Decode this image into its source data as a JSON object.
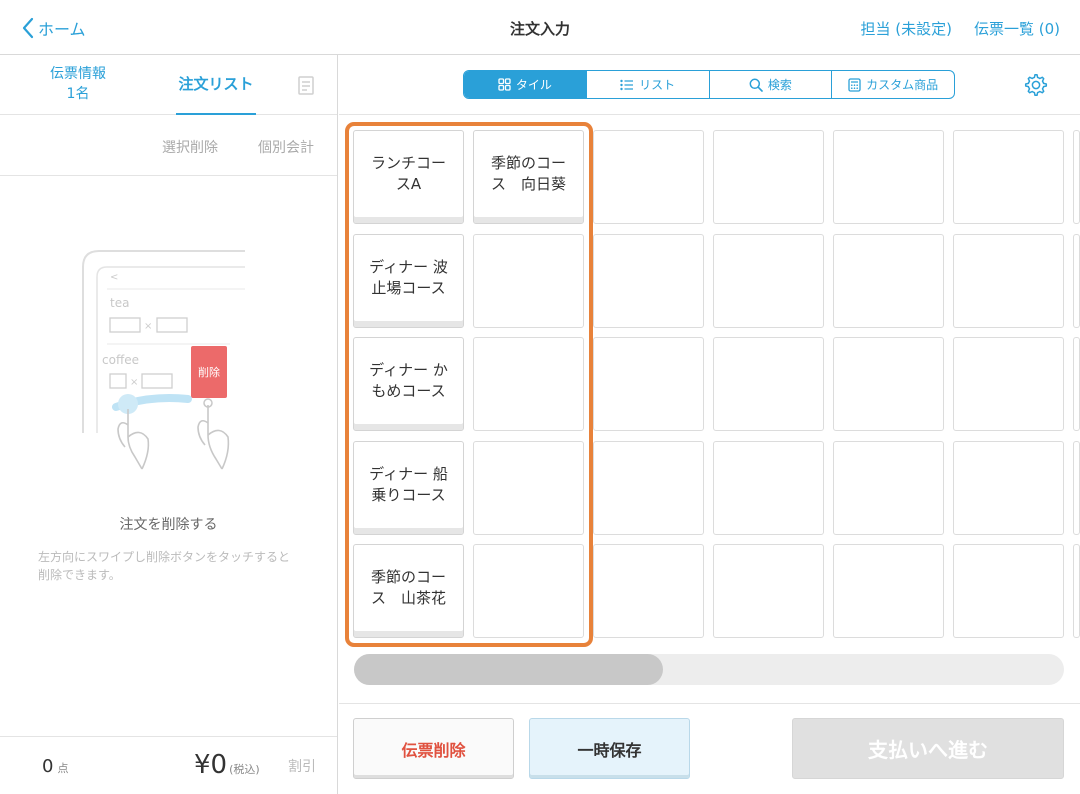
{
  "header": {
    "back_label": "ホーム",
    "title": "注文入力",
    "staff_label": "担当 (未設定)",
    "slips_label": "伝票一覧 (0)"
  },
  "left": {
    "tab_info_line1": "伝票情報",
    "tab_info_line2": "1名",
    "tab_orders": "注文リスト",
    "action_delete_selected": "選択削除",
    "action_split_bill": "個別会計",
    "illustration": {
      "item1": "tea",
      "item2": "coffee",
      "delete_label": "削除"
    },
    "empty_title": "注文を削除する",
    "empty_desc": "左方向にスワイプし削除ボタンをタッチすると削除できます。",
    "footer": {
      "count_value": "0",
      "count_unit": "点",
      "total_value": "¥0",
      "total_tax": "(税込)",
      "discount": "割引"
    }
  },
  "right": {
    "view_modes": [
      {
        "label": "タイル",
        "icon": "grid-icon",
        "active": true
      },
      {
        "label": "リスト",
        "icon": "list-icon",
        "active": false
      },
      {
        "label": "検索",
        "icon": "search-icon",
        "active": false
      },
      {
        "label": "カスタム商品",
        "icon": "calculator-icon",
        "active": false
      }
    ],
    "products": [
      {
        "label": "ランチコー\nスA"
      },
      {
        "label": "季節のコー\nス　向日葵"
      },
      {
        "label": "ディナー 波\n止場コース"
      },
      {
        "label": "ディナー か\nもめコース"
      },
      {
        "label": "ディナー 船\n乗りコース"
      },
      {
        "label": "季節のコー\nス　山茶花"
      }
    ],
    "scroll_position": 0.0
  },
  "actions": {
    "delete_slip": "伝票削除",
    "hold": "一時保存",
    "checkout": "支払いへ進む"
  },
  "colors": {
    "accent": "#2aa0d8",
    "highlight": "#e8823a",
    "danger": "#e0513f"
  }
}
